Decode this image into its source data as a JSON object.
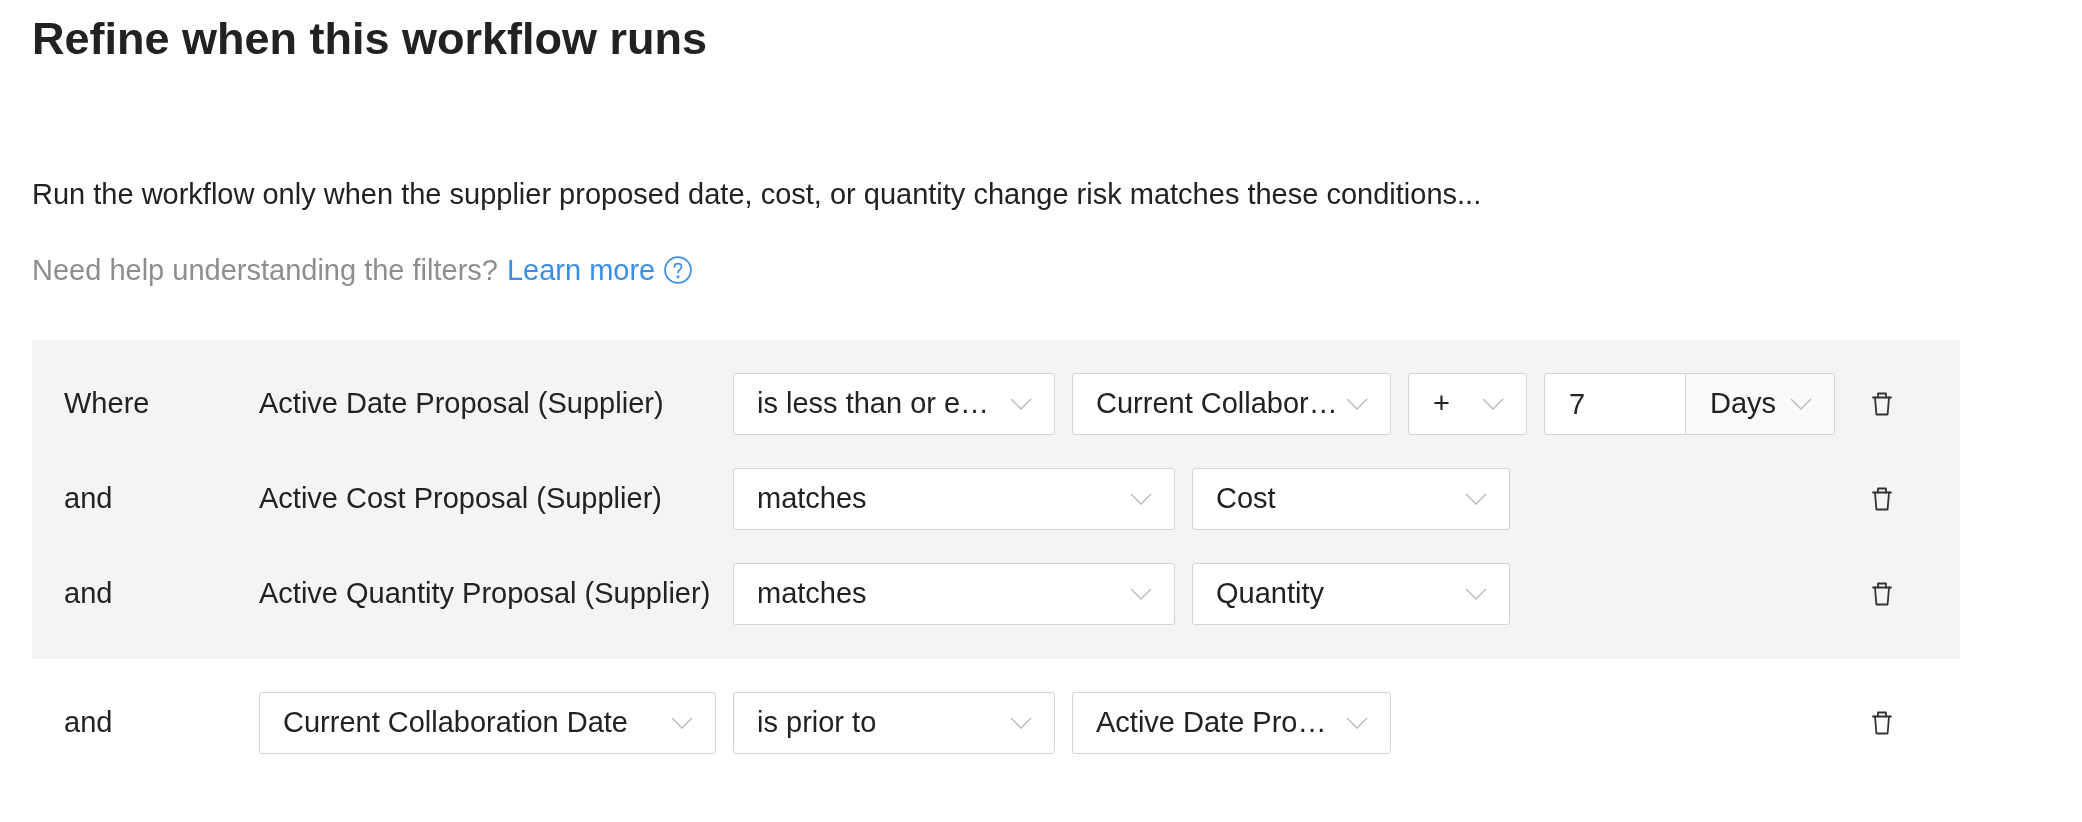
{
  "title": "Refine when this workflow runs",
  "description": "Run the workflow only when the supplier proposed date, cost, or quantity change risk matches these conditions...",
  "help": {
    "text": "Need help understanding the filters?",
    "link": "Learn more"
  },
  "grouped_conditions": [
    {
      "conjunction": "Where",
      "field": {
        "kind": "text",
        "value": "Active Date Proposal (Supplier)"
      },
      "controls": [
        {
          "kind": "dropdown",
          "value": "is less than or e…"
        },
        {
          "kind": "dropdown",
          "value": "Current Collabor…"
        },
        {
          "kind": "sign",
          "value": "+"
        },
        {
          "kind": "quantity",
          "value": "7",
          "unit": "Days"
        }
      ]
    },
    {
      "conjunction": "and",
      "field": {
        "kind": "text",
        "value": "Active Cost Proposal (Supplier)"
      },
      "controls": [
        {
          "kind": "dropdown",
          "value": "matches"
        },
        {
          "kind": "dropdown",
          "value": "Cost"
        }
      ]
    },
    {
      "conjunction": "and",
      "field": {
        "kind": "text",
        "value": "Active Quantity Proposal (Supplier)"
      },
      "controls": [
        {
          "kind": "dropdown",
          "value": "matches"
        },
        {
          "kind": "dropdown",
          "value": "Quantity"
        }
      ]
    }
  ],
  "conditions": [
    {
      "conjunction": "and",
      "field": {
        "kind": "dropdown",
        "value": "Current Collaboration Date"
      },
      "controls": [
        {
          "kind": "dropdown",
          "value": "is prior to"
        },
        {
          "kind": "dropdown",
          "value": "Active Date Pro…"
        }
      ]
    }
  ]
}
